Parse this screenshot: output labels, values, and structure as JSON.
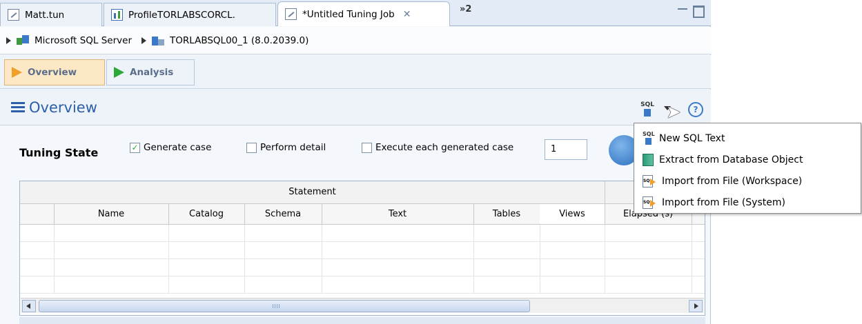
{
  "tabs": [
    {
      "label": "Matt.tun",
      "icon": "tuning-file-icon",
      "active": false
    },
    {
      "label": "ProfileTORLABSCORCL.",
      "icon": "profile-chart-icon",
      "active": false
    },
    {
      "label": "*Untitled Tuning Job",
      "icon": "tuning-file-icon",
      "active": true
    }
  ],
  "tab_overflow": "»2",
  "breadcrumb": {
    "server": "Microsoft SQL Server",
    "database": "TORLABSQL00_1 (8.0.2039.0)"
  },
  "mode_buttons": {
    "overview": "Overview",
    "analysis": "Analysis"
  },
  "section_title": "Overview",
  "toolbar": {
    "sql_icon_text": "SQL",
    "help_glyph": "?"
  },
  "tuning_state": {
    "label": "Tuning State",
    "generate_case": {
      "label": "Generate case",
      "checked": true
    },
    "perform_detail": {
      "label": "Perform detail",
      "checked": false
    },
    "execute_each": {
      "label": "Execute each generated case",
      "checked": false
    },
    "execute_count": "1"
  },
  "table": {
    "group_header": "Statement",
    "columns": [
      "",
      "Name",
      "Catalog",
      "Schema",
      "Text",
      "Tables",
      "Views",
      "Elapsed (s)"
    ],
    "rows": 4
  },
  "menu": {
    "items": [
      {
        "label": "New SQL Text",
        "icon": "new-sql-text-icon"
      },
      {
        "label": "Extract from Database Object",
        "icon": "database-object-icon"
      },
      {
        "label": "Import from File (Workspace)",
        "icon": "import-file-icon"
      },
      {
        "label": "Import from File (System)",
        "icon": "import-file-icon"
      }
    ]
  },
  "colors": {
    "accent": "#2b5fa8",
    "selected_mode": "#fce8c5",
    "run_button": "#2b6fc0"
  }
}
